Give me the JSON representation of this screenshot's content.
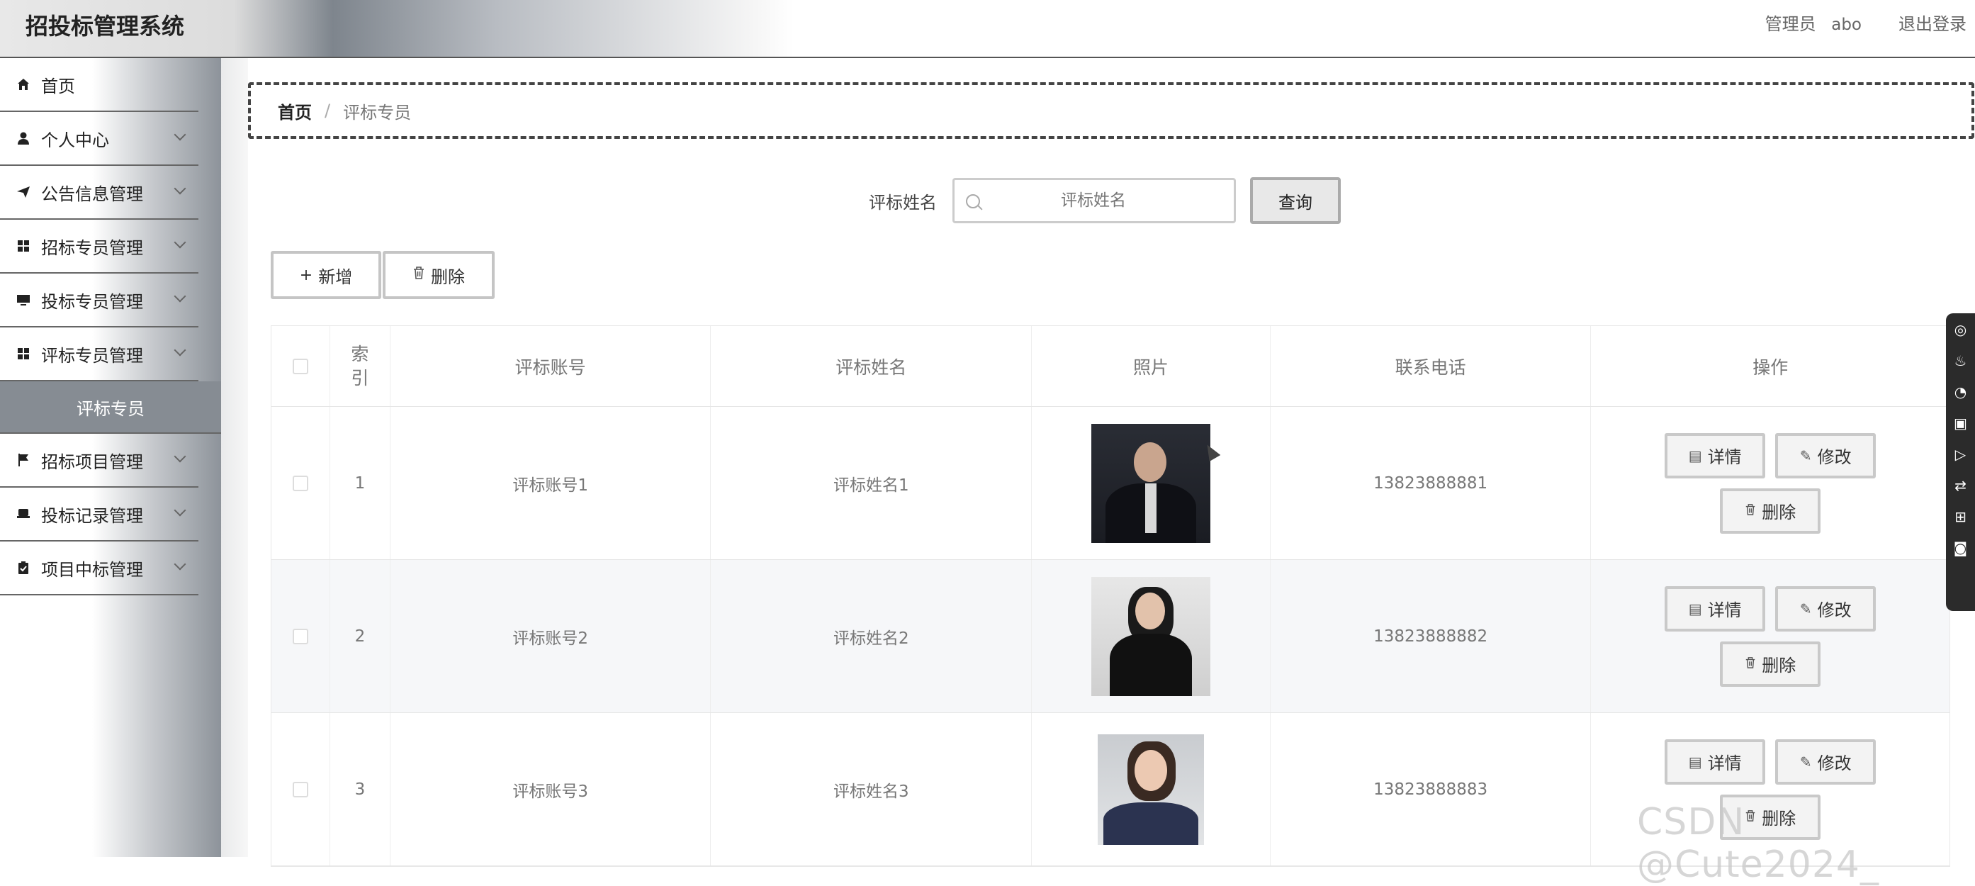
{
  "header": {
    "title": "招投标管理系统",
    "role": "管理员",
    "username": "abo",
    "logout": "退出登录"
  },
  "sidebar": {
    "items": [
      {
        "label": "首页",
        "icon": "home-icon",
        "expandable": false
      },
      {
        "label": "个人中心",
        "icon": "user-icon",
        "expandable": true
      },
      {
        "label": "公告信息管理",
        "icon": "send-icon",
        "expandable": true
      },
      {
        "label": "招标专员管理",
        "icon": "grid-icon",
        "expandable": true
      },
      {
        "label": "投标专员管理",
        "icon": "monitor-icon",
        "expandable": true
      },
      {
        "label": "评标专员管理",
        "icon": "grid-icon",
        "expandable": true
      },
      {
        "label": "招标项目管理",
        "icon": "flag-icon",
        "expandable": true
      },
      {
        "label": "投标记录管理",
        "icon": "printer-icon",
        "expandable": true
      },
      {
        "label": "项目中标管理",
        "icon": "clipboard-check-icon",
        "expandable": true
      }
    ],
    "active_sub": "评标专员"
  },
  "breadcrumb": {
    "home": "首页",
    "separator": "/",
    "current": "评标专员"
  },
  "search": {
    "label": "评标姓名",
    "placeholder": "评标姓名",
    "button": "查询"
  },
  "actions": {
    "add": "新增",
    "delete": "删除"
  },
  "table": {
    "headers": {
      "index": "索引",
      "account": "评标账号",
      "name": "评标姓名",
      "photo": "照片",
      "phone": "联系电话",
      "ops": "操作"
    },
    "rows": [
      {
        "index": "1",
        "account": "评标账号1",
        "name": "评标姓名1",
        "phone": "13823888881"
      },
      {
        "index": "2",
        "account": "评标账号2",
        "name": "评标姓名2",
        "phone": "13823888882"
      },
      {
        "index": "3",
        "account": "评标账号3",
        "name": "评标姓名3",
        "phone": "13823888883"
      }
    ],
    "row_buttons": {
      "detail": "详情",
      "edit": "修改",
      "delete": "删除"
    }
  },
  "watermark": "CSDN @Cute2024_"
}
